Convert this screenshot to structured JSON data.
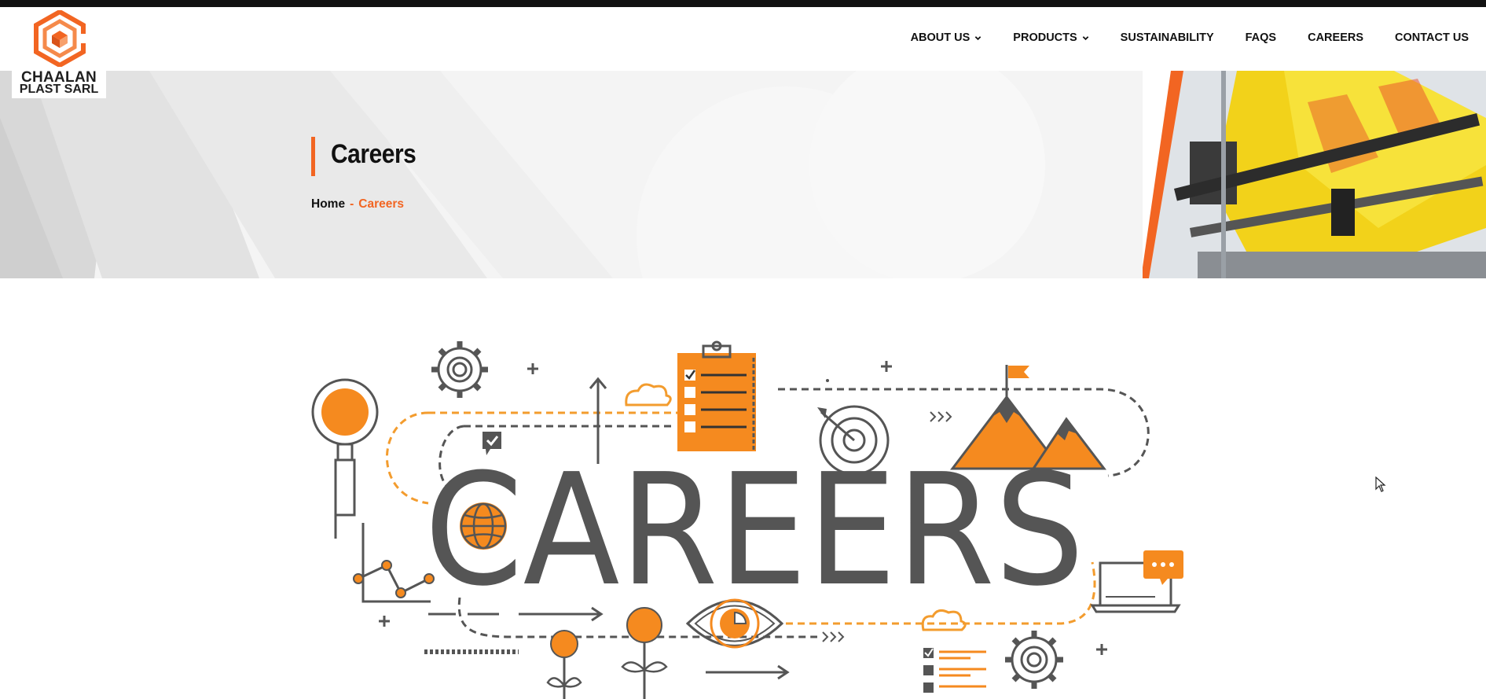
{
  "brand": {
    "line1": "CHAALAN",
    "line2": "PLAST SARL",
    "accent_color": "#f26522",
    "dark_color": "#111111"
  },
  "nav": {
    "items": [
      {
        "label": "ABOUT US",
        "has_dropdown": true
      },
      {
        "label": "PRODUCTS",
        "has_dropdown": true
      },
      {
        "label": "SUSTAINABILITY",
        "has_dropdown": false
      },
      {
        "label": "FAQS",
        "has_dropdown": false
      },
      {
        "label": "CAREERS",
        "has_dropdown": false
      },
      {
        "label": "CONTACT US",
        "has_dropdown": false
      }
    ]
  },
  "hero": {
    "title": "Careers",
    "breadcrumb": {
      "home": "Home",
      "separator": "-",
      "current": "Careers"
    }
  },
  "illustration": {
    "word": "CAREERS",
    "icons": [
      "gear-icon",
      "magnifier-icon",
      "clipboard-checklist-icon",
      "cloud-icon",
      "target-icon",
      "mountain-flag-icon",
      "globe-icon",
      "line-chart-icon",
      "eye-icon",
      "laptop-chat-icon",
      "flower-icon",
      "checklist-icon"
    ]
  }
}
